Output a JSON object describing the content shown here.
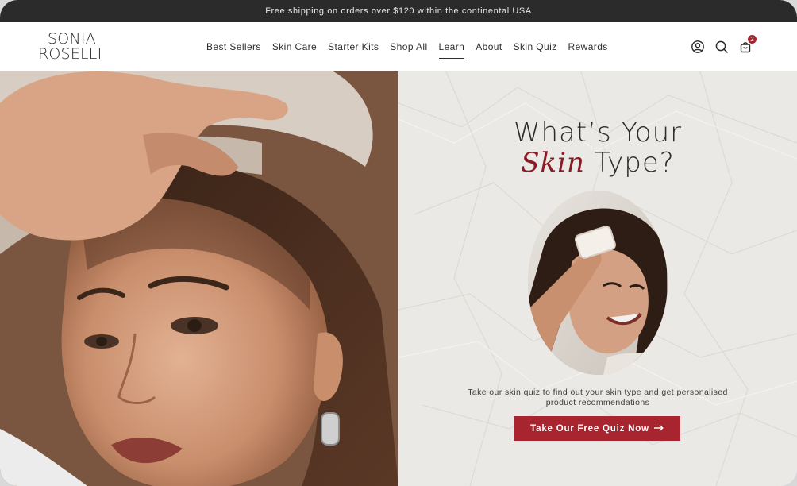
{
  "announcement": {
    "text": "Free shipping on orders over $120 within the continental USA"
  },
  "brand": {
    "line1": "SONIA",
    "line2": "ROSELLI"
  },
  "nav": {
    "items": [
      {
        "label": "Best Sellers"
      },
      {
        "label": "Skin Care"
      },
      {
        "label": "Starter Kits"
      },
      {
        "label": "Shop All"
      },
      {
        "label": "Learn",
        "active": true
      },
      {
        "label": "About"
      },
      {
        "label": "Skin Quiz"
      },
      {
        "label": "Rewards"
      }
    ]
  },
  "header_icons": {
    "account": "user-icon",
    "search": "search-icon",
    "cart": "bag-icon",
    "cart_count": "2"
  },
  "hero": {
    "headline_line1": "What’s Your",
    "headline_accent": "Skin",
    "headline_rest": " Type?",
    "blurb": "Take our skin quiz to find out your skin type and get personalised product recommendations",
    "cta_label": "Take Our Free Quiz Now",
    "cta_icon": "arrow-right-icon"
  },
  "colors": {
    "accent": "#a8252f",
    "headline_accent": "#8a1b24",
    "announcement_bg": "#2b2b2b",
    "right_panel_bg": "#ebe9e5"
  }
}
